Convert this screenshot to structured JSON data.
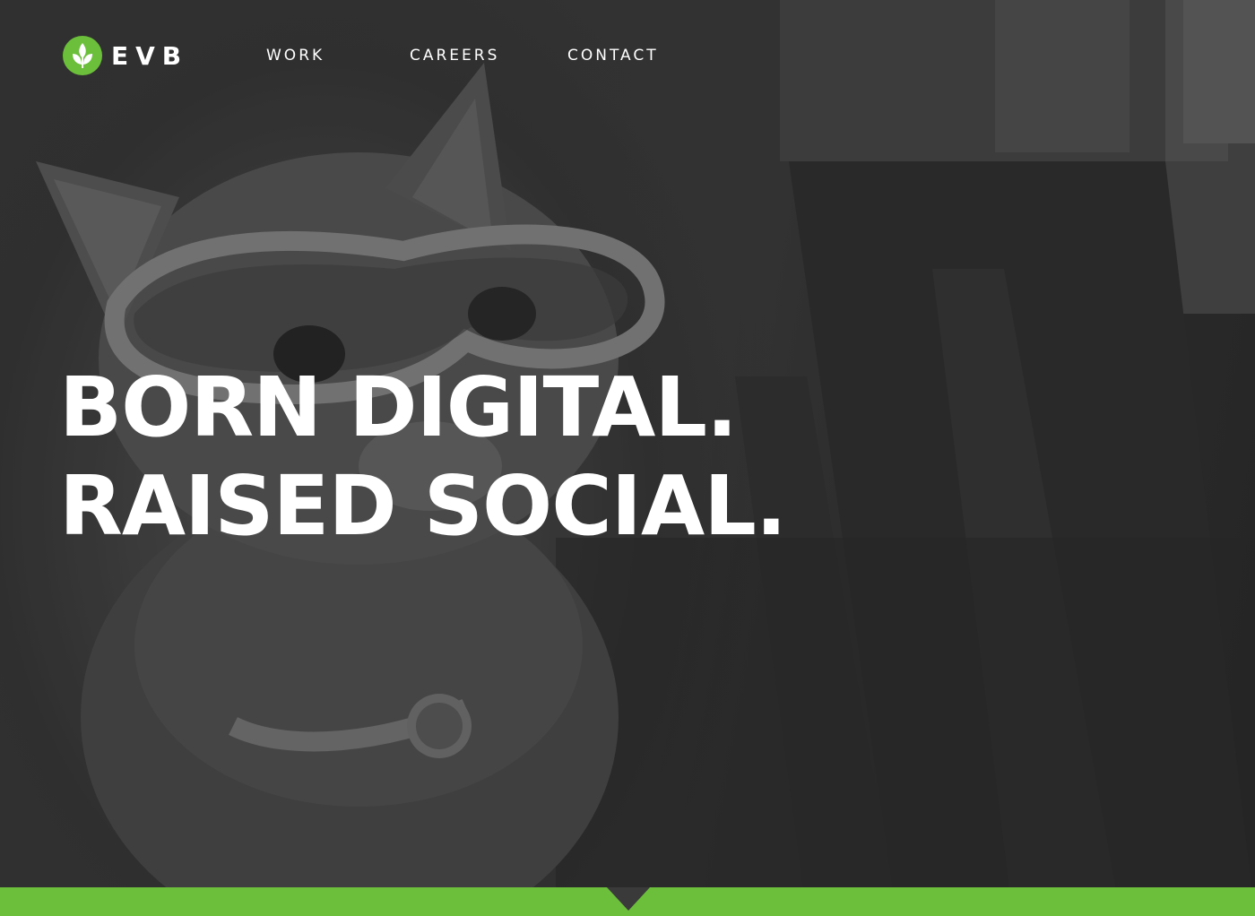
{
  "brand": {
    "logo_text": "EVB",
    "logo_icon": "leaf-icon",
    "accent_color": "#6cbf3a"
  },
  "nav": {
    "items": [
      {
        "label": "WORK"
      },
      {
        "label": "CAREERS"
      },
      {
        "label": "CONTACT"
      }
    ]
  },
  "hero": {
    "headline_line_1": "BORN DIGITAL.",
    "headline_line_2": "RAISED SOCIAL.",
    "background_image": "cat-with-goggles-photo"
  },
  "footer_bar": {
    "color": "#6cbf3a",
    "scroll_icon": "scroll-down-arrow-icon"
  }
}
